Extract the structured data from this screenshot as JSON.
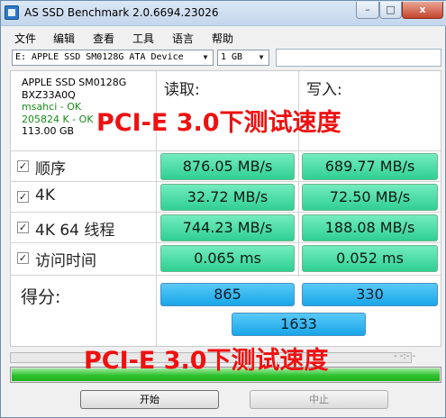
{
  "window": {
    "title": "AS SSD Benchmark 2.0.6694.23026",
    "min_glyph": "–",
    "max_glyph": "□",
    "close_glyph": "x"
  },
  "menu": [
    "文件",
    "编辑",
    "查看",
    "工具",
    "语言",
    "帮助"
  ],
  "toolbar": {
    "drive": "E: APPLE SSD SM0128G ATA Device",
    "size": "1 GB"
  },
  "drive_info": {
    "model": "APPLE SSD SM0128G",
    "firmware": "BXZ33A0Q",
    "driver": "msahci - OK",
    "alignment": "205824 K - OK",
    "capacity": "113.00 GB"
  },
  "columns": {
    "read": "读取:",
    "write": "写入:"
  },
  "tests": [
    {
      "label": "顺序",
      "read": "876.05 MB/s",
      "write": "689.77 MB/s"
    },
    {
      "label": "4K",
      "read": "32.72 MB/s",
      "write": "72.50 MB/s"
    },
    {
      "label": "4K 64 线程",
      "read": "744.23 MB/s",
      "write": "188.08 MB/s"
    },
    {
      "label": "访问时间",
      "read": "0.065 ms",
      "write": "0.052 ms"
    }
  ],
  "score": {
    "label": "得分:",
    "read": "865",
    "write": "330",
    "total": "1633"
  },
  "progress": {
    "fraction": 1.0,
    "dash": "- -:- -"
  },
  "buttons": {
    "start": "开始",
    "stop": "中止"
  },
  "watermark": "PCI-E 3.0下测试速度",
  "colors": {
    "result_green": "#3fd89c",
    "score_blue": "#22aeea",
    "watermark_red": "#ee1111",
    "progress_green": "#2fc32f"
  }
}
